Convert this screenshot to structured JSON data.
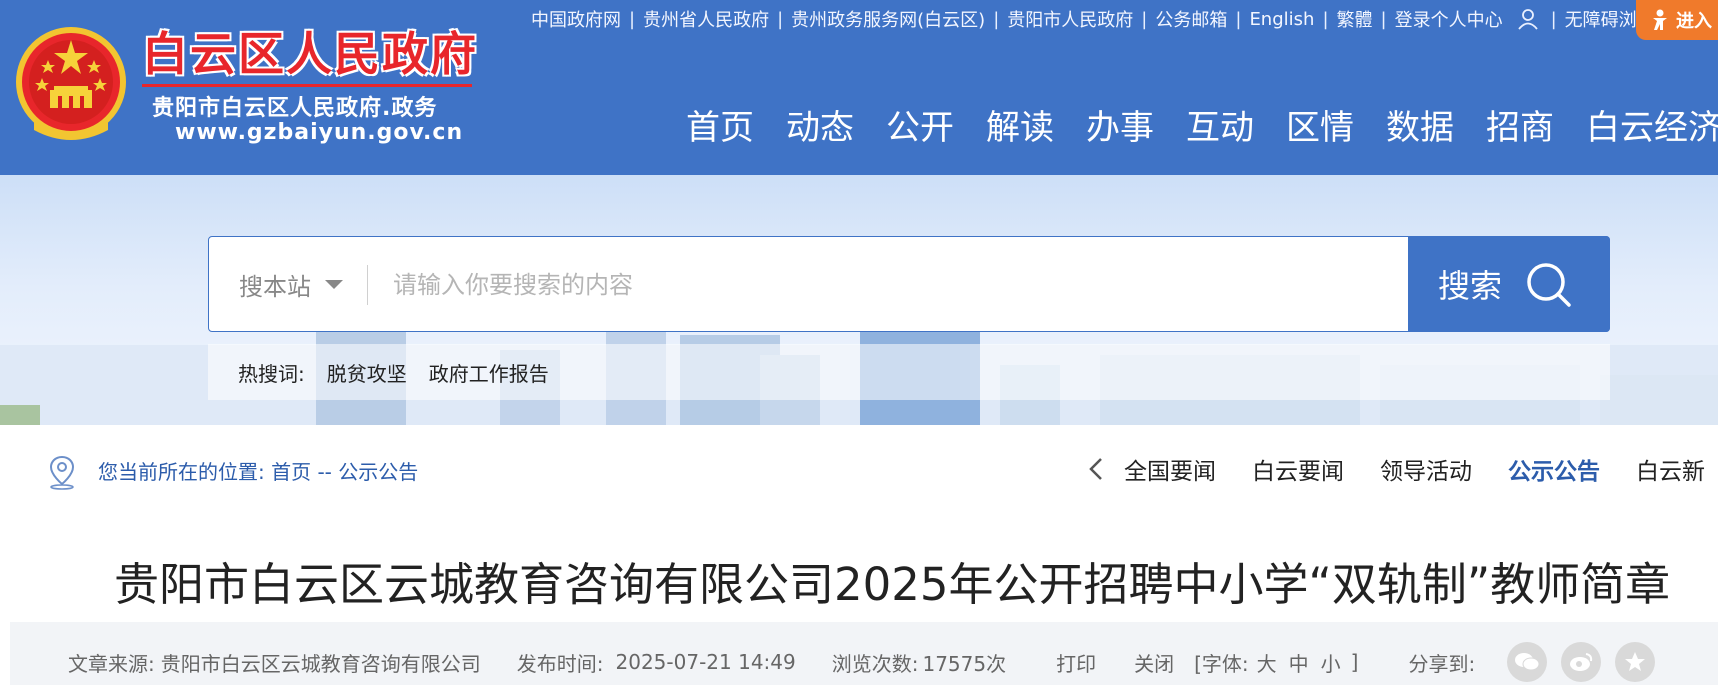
{
  "header": {
    "site_title": "白云区人民政府",
    "site_subtitle": "贵阳市白云区人民政府.政务",
    "site_url": "www.gzbaiyun.gov.cn",
    "top_links": [
      "中国政府网",
      "贵州省人民政府",
      "贵州政务服务网(白云区)",
      "贵阳市人民政府",
      "公务邮箱",
      "English",
      "繁體",
      "登录个人中心"
    ],
    "accessibility_link": "无障碍浏览",
    "enter_button": "进入",
    "nav": [
      "首页",
      "动态",
      "公开",
      "解读",
      "办事",
      "互动",
      "区情",
      "数据",
      "招商",
      "白云经济开"
    ]
  },
  "search": {
    "scope_label": "搜本站",
    "placeholder": "请输入你要搜索的内容",
    "button_label": "搜索",
    "hot_label": "热搜词:",
    "hot_words": [
      "脱贫攻坚",
      "政府工作报告"
    ]
  },
  "breadcrumb": {
    "prefix": "您当前所在的位置:",
    "home": "首页",
    "separator": "--",
    "current": "公示公告"
  },
  "subnav": {
    "items": [
      "全国要闻",
      "白云要闻",
      "领导活动",
      "公示公告",
      "白云新"
    ],
    "active": "公示公告"
  },
  "article": {
    "title": "贵阳市白云区云城教育咨询有限公司2025年公开招聘中小学“双轨制”教师简章",
    "source_label": "文章来源:",
    "source": "贵阳市白云区云城教育咨询有限公司",
    "published_label": "发布时间:",
    "published": "2025-07-21 14:49",
    "views_label": "浏览次数:",
    "views": "17575次",
    "print_label": "打印",
    "close_label": "关闭",
    "font_label": "[字体:",
    "font_large": "大",
    "font_medium": "中",
    "font_small": "小",
    "font_end": "]",
    "share_label": "分享到:",
    "share_icons": [
      "wechat-icon",
      "weibo-icon",
      "qzone-icon"
    ]
  },
  "colors": {
    "header_blue": "#3f73c6",
    "title_red": "#e8262b",
    "accent_orange": "#f07a2b",
    "link_blue": "#2c5cab"
  }
}
